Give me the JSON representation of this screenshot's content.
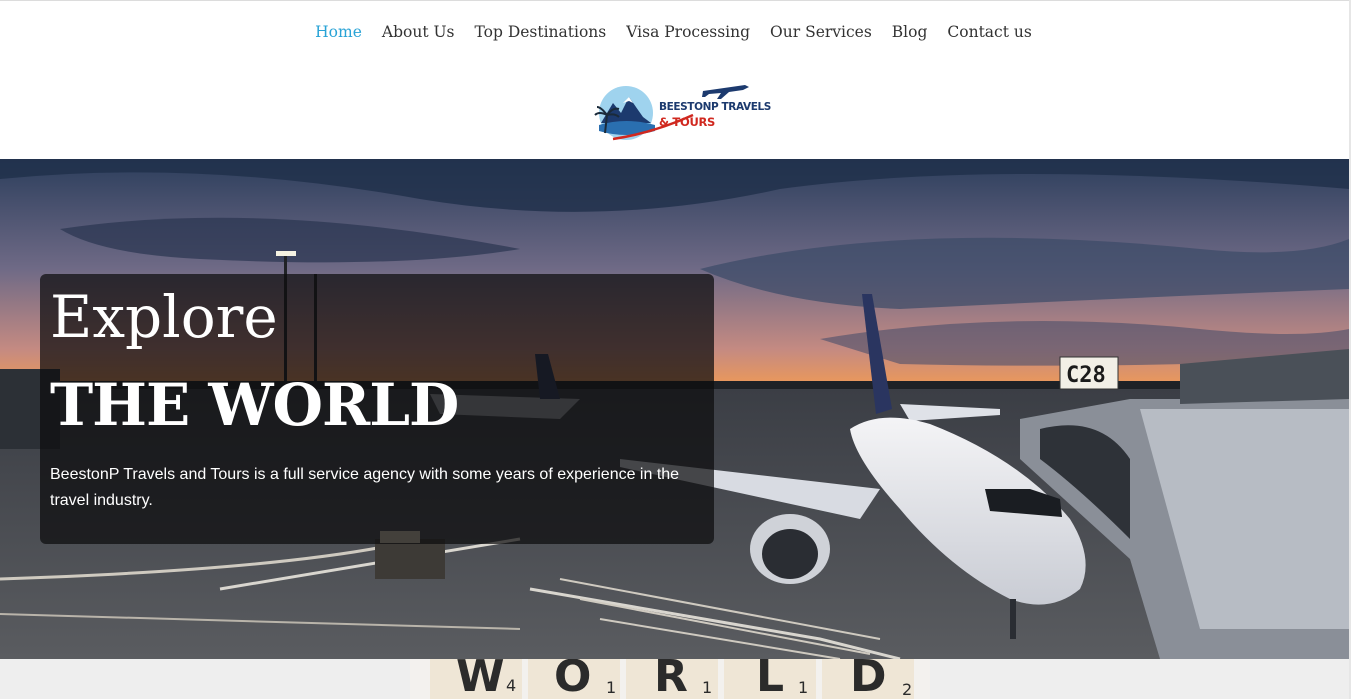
{
  "nav": {
    "items": [
      {
        "label": "Home",
        "active": true
      },
      {
        "label": "About Us",
        "active": false
      },
      {
        "label": "Top Destinations",
        "active": false
      },
      {
        "label": "Visa Processing",
        "active": false
      },
      {
        "label": "Our Services",
        "active": false
      },
      {
        "label": "Blog",
        "active": false
      },
      {
        "label": "Contact us",
        "active": false
      }
    ]
  },
  "logo": {
    "line1": "BEESTONP TRAVELS",
    "line2": "& TOURS",
    "icon": "airplane-mountain-logo"
  },
  "hero": {
    "eyebrow": "Explore",
    "title": "THE WORLD",
    "description": "BeestonP Travels and Tours  is a full service agency with some years of experience in the travel industry.",
    "gate_sign": "C28"
  },
  "bottom": {
    "tile_letters": [
      "W",
      "O",
      "R",
      "L",
      "D"
    ],
    "tile_numbers": [
      "4",
      "1",
      "1",
      "1",
      "2"
    ]
  },
  "colors": {
    "accent": "#29a3d6",
    "nav_text": "#333333",
    "card_bg": "rgba(12,12,14,0.72)",
    "logo_navy": "#1c3a6e",
    "logo_red": "#d0281f"
  }
}
